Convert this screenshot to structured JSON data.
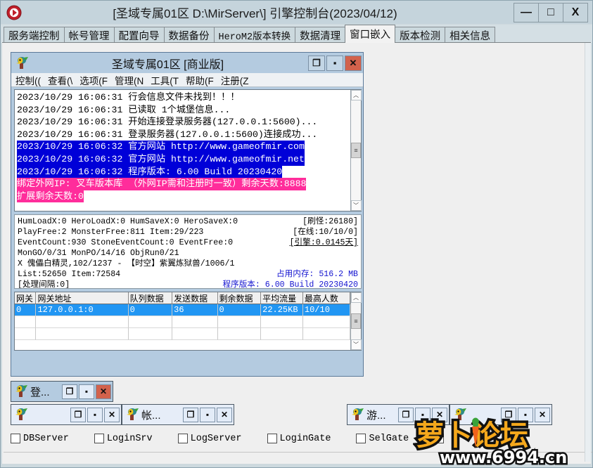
{
  "window": {
    "title": "[圣域专属01区 D:\\MirServer\\] 引擎控制台(2023/04/12)",
    "app_icon": "record-icon",
    "minimize": "—",
    "maximize": "□",
    "close": "X"
  },
  "tabs": [
    {
      "label": "服务端控制",
      "active": false,
      "mono": false
    },
    {
      "label": "帐号管理",
      "active": false,
      "mono": false
    },
    {
      "label": "配置向导",
      "active": false,
      "mono": false
    },
    {
      "label": "数据备份",
      "active": false,
      "mono": false
    },
    {
      "label": "HeroM2版本转换",
      "active": false,
      "mono": true
    },
    {
      "label": "数据清理",
      "active": false,
      "mono": false
    },
    {
      "label": "窗口嵌入",
      "active": true,
      "mono": false
    },
    {
      "label": "版本检测",
      "active": false,
      "mono": false
    },
    {
      "label": "相关信息",
      "active": false,
      "mono": false
    }
  ],
  "inner_window": {
    "title": "圣域专属01区 [商业版]",
    "icon": "mir-icon",
    "restore": "❐",
    "maximize": "▪",
    "close": "✕",
    "menu": [
      "控制((",
      "查看(\\",
      "选项(F",
      "管理(N",
      "工具(T",
      "帮助(F",
      "注册(Z"
    ]
  },
  "log": {
    "lines": [
      {
        "text": "2023/10/29 16:06:31 行会信息文件未找到！！！",
        "style": "normal"
      },
      {
        "text": "2023/10/29 16:06:31 已读取 1个城堡信息...",
        "style": "normal"
      },
      {
        "text": "2023/10/29 16:06:31 开始连接登录服务器(127.0.0.1:5600)...",
        "style": "normal"
      },
      {
        "text": "2023/10/29 16:06:31 登录服务器(127.0.0.1:5600)连接成功...",
        "style": "normal"
      },
      {
        "text": "2023/10/29 16:06:32 官方网站 http://www.gameofmir.com",
        "style": "selected"
      },
      {
        "text": "2023/10/29 16:06:32 官方网站 http://www.gameofmir.net",
        "style": "selected"
      },
      {
        "text": "2023/10/29 16:06:32 程序版本: 6.00 Build 20230420",
        "style": "selected"
      },
      {
        "text": "绑定外网IP: 叉车版本库  （外网IP需和注册时一致）剩余天数:8888",
        "style": "pink"
      },
      {
        "text": "扩展剩余天数:0",
        "style": "pink"
      }
    ],
    "scroll_up": "︿",
    "scroll_down": "﹀",
    "thumb": "≡"
  },
  "stats": [
    {
      "left": "HumLoadX:0 HeroLoadX:0 HumSaveX:0 HeroSaveX:0",
      "right": "[刷怪:26180]",
      "right_color": "black",
      "underline": false
    },
    {
      "left": "PlayFree:2 MonsterFree:811 Item:29/223",
      "right": "[在线:10/10/0]",
      "right_color": "black",
      "underline": false
    },
    {
      "left": "EventCount:930 StoneEventCount:0 EventFree:0",
      "right": "[引擎:0.0145天]",
      "right_color": "black",
      "underline": true
    },
    {
      "left": "MonGO/0/31 MonPO/14/16 ObjRun0/21",
      "right": "",
      "right_color": "black",
      "underline": false
    },
    {
      "left": "X 傀儡白精灵,102/1237 - 【时空】紫翼炼狱兽/1006/1",
      "right": "",
      "right_color": "black",
      "underline": false
    },
    {
      "left": "List:52650 Item:72584",
      "right": "占用内存: 516.2 MB",
      "right_color": "blue",
      "underline": false
    },
    {
      "left": "[处理间隔:0]",
      "right": "程序版本: 6.00 Build 20230420",
      "right_color": "blue",
      "underline": false
    }
  ],
  "gateway_table": {
    "headers": [
      "网关",
      "网关地址",
      "队列数据",
      "发送数据",
      "剩余数据",
      "平均流量",
      "最高人数"
    ],
    "rows": [
      {
        "cells": [
          "0",
          "127.0.0.1:0",
          "0",
          "36",
          "0",
          "22.25KB",
          "10/10"
        ],
        "selected": true
      },
      {
        "cells": [
          "",
          "",
          "",
          "",
          "",
          "",
          ""
        ],
        "selected": false
      },
      {
        "cells": [
          "",
          "",
          "",
          "",
          "",
          "",
          ""
        ],
        "selected": false
      }
    ],
    "scroll_up": "︿",
    "thumb": "≡",
    "scroll_down": "﹀"
  },
  "embedded_windows": [
    {
      "label": "登...",
      "icon": "mir-icon",
      "active": true,
      "close_red": true,
      "restore": "❐",
      "maximize": "▪",
      "close": "✕"
    },
    {
      "label": "",
      "icon": "mir-icon",
      "active": false,
      "close_red": false,
      "restore": "❐",
      "maximize": "▪",
      "close": "✕"
    },
    {
      "label": "帐...",
      "icon": "mir-icon",
      "active": false,
      "close_red": false,
      "restore": "❐",
      "maximize": "▪",
      "close": "✕"
    },
    {
      "label": "游...",
      "icon": "mir-icon",
      "active": false,
      "close_red": false,
      "restore": "❐",
      "maximize": "▪",
      "close": "✕"
    },
    {
      "label": "",
      "icon": "mir-icon",
      "active": false,
      "close_red": false,
      "restore": "❐",
      "maximize": "▪",
      "close": "✕"
    }
  ],
  "checkboxes": [
    {
      "label": "DBServer",
      "checked": false
    },
    {
      "label": "LoginSrv",
      "checked": false
    },
    {
      "label": "LogServer",
      "checked": false
    },
    {
      "label": "LoginGate",
      "checked": false
    },
    {
      "label": "SelGate",
      "checked": false
    },
    {
      "label": "",
      "checked": false
    }
  ],
  "watermark": {
    "text": "萝卜论坛",
    "url": "www.6994.cn"
  },
  "colors": {
    "titlebar": "#c5d4dc",
    "inner_titlebar": "#b4cbe0",
    "selection_blue": "#0000d8",
    "pink_highlight": "#ff2d9b",
    "row_select": "#2196f3",
    "close_red": "#d2624c",
    "stat_blue": "#1515d0"
  }
}
